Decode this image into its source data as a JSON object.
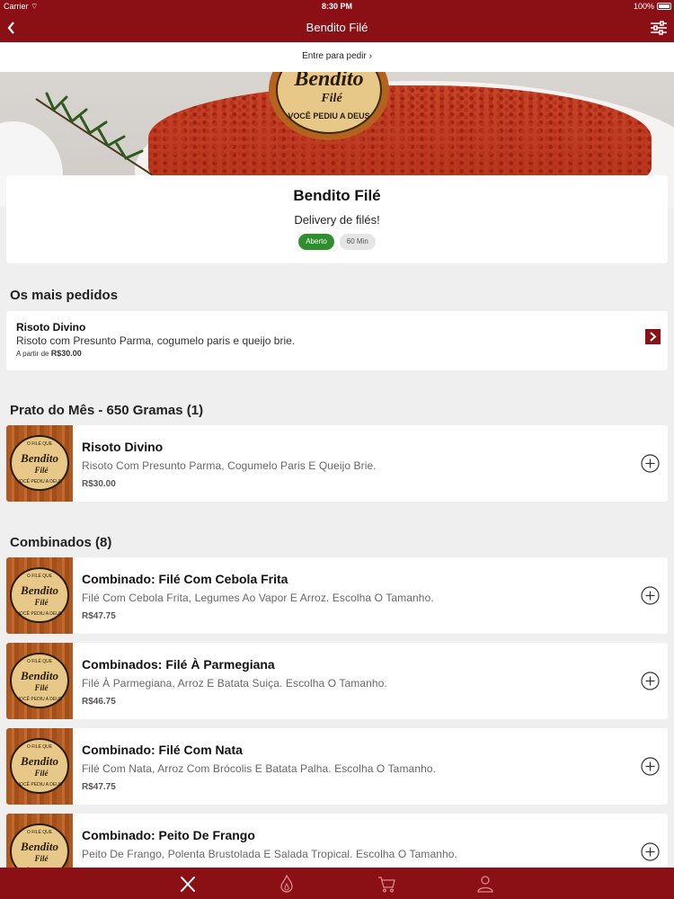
{
  "status_bar": {
    "carrier": "Carrier ⌔",
    "time": "8:30 PM",
    "battery": "100%"
  },
  "nav": {
    "title": "Bendito Filé"
  },
  "login_bar": {
    "label": "Entre para pedir ›"
  },
  "hero": {
    "logo_text": "Bendito",
    "logo_sub": "Filé",
    "logo_tagline": "VOCÊ PEDIU A DEUS"
  },
  "restaurant": {
    "name": "Bendito Filé",
    "description": "Delivery de filés!",
    "status": "Aberto",
    "delivery_time": "60 Min"
  },
  "most_ordered": {
    "title": "Os mais pedidos",
    "item": {
      "name": "Risoto Divino",
      "description": "Risoto com Presunto Parma, cogumelo paris e queijo brie.",
      "price_prefix": "A partir de",
      "price": "R$30.00"
    }
  },
  "sections": [
    {
      "title": "Prato do Mês - 650 Gramas (1)",
      "items": [
        {
          "name": "Risoto Divino",
          "description": "Risoto Com Presunto Parma, Cogumelo Paris E Queijo Brie.",
          "price": "R$30.00"
        }
      ]
    },
    {
      "title": "Combinados (8)",
      "items": [
        {
          "name": "Combinado: Filé Com Cebola Frita",
          "description": "Filé Com Cebola Frita, Legumes Ao Vapor E Arroz. Escolha O Tamanho.",
          "price": "R$47.75"
        },
        {
          "name": "Combinados: Filé À Parmegiana",
          "description": "Filé À Parmegiana, Arroz E Batata Suiça. Escolha O Tamanho.",
          "price": "R$46.75"
        },
        {
          "name": "Combinado: Filé Com Nata",
          "description": "Filé Com Nata, Arroz Com Brócolis E Batata Palha. Escolha O Tamanho.",
          "price": "R$47.75"
        },
        {
          "name": "Combinado: Peito De Frango",
          "description": "Peito De Frango, Polenta Brustolada E Salada Tropical. Escolha O Tamanho.",
          "price": ""
        }
      ]
    }
  ],
  "thumb_logo": {
    "top": "O FILÉ QUE",
    "main": "Bendito",
    "sub": "Filé",
    "tagline": "VOCÊ PEDIU A DEUS"
  },
  "tabbar": {
    "items": [
      {
        "icon": "fork-knife-icon",
        "active": true
      },
      {
        "icon": "flame-icon",
        "active": false
      },
      {
        "icon": "cart-icon",
        "active": false
      },
      {
        "icon": "user-icon",
        "active": false
      }
    ]
  },
  "colors": {
    "brand": "#8b1016",
    "open_green": "#2f8f2f",
    "background": "#efefef"
  }
}
